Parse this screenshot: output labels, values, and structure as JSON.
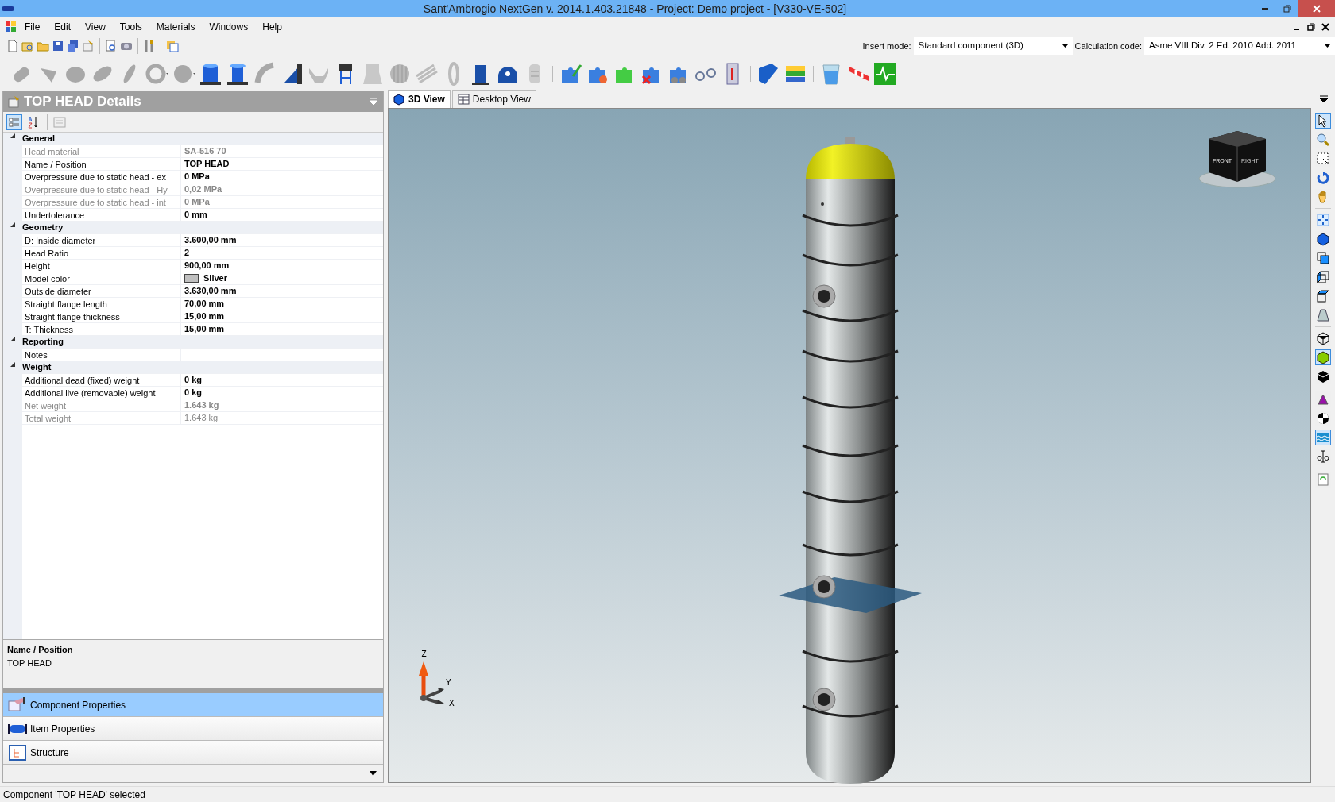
{
  "window": {
    "title": "Sant'Ambrogio NextGen  v. 2014.1.403.21848 - Project: Demo project - [V330-VE-502]"
  },
  "menu": [
    {
      "label": "File"
    },
    {
      "label": "Edit"
    },
    {
      "label": "View"
    },
    {
      "label": "Tools"
    },
    {
      "label": "Materials"
    },
    {
      "label": "Windows"
    },
    {
      "label": "Help"
    }
  ],
  "insert_mode": {
    "label": "Insert mode:",
    "value": "Standard component (3D)"
  },
  "calculation_code": {
    "label": "Calculation code:",
    "value": "Asme VIII Div. 2 Ed. 2010 Add. 2011"
  },
  "details_panel": {
    "title": "TOP HEAD Details",
    "categories": [
      {
        "name": "General",
        "expanded": true,
        "properties": [
          {
            "label": "Head material",
            "value": "SA-516 70",
            "readonly": true,
            "bold": true
          },
          {
            "label": "Name / Position",
            "value": "TOP HEAD",
            "readonly": false,
            "bold": true
          },
          {
            "label": "Overpressure due to static head - ex",
            "value": "0 MPa",
            "readonly": false,
            "bold": true
          },
          {
            "label": "Overpressure due to static head - Hy",
            "value": "0,02 MPa",
            "readonly": true,
            "bold": true
          },
          {
            "label": "Overpressure due to static head - int",
            "value": "0 MPa",
            "readonly": true,
            "bold": true
          },
          {
            "label": "Undertolerance",
            "value": "0 mm",
            "readonly": false,
            "bold": true
          }
        ]
      },
      {
        "name": "Geometry",
        "expanded": true,
        "properties": [
          {
            "label": "D:  Inside diameter",
            "value": "3.600,00 mm",
            "readonly": false,
            "bold": true
          },
          {
            "label": "Head Ratio",
            "value": "2",
            "readonly": false,
            "bold": true
          },
          {
            "label": "Height",
            "value": "900,00 mm",
            "readonly": false,
            "bold": true
          },
          {
            "label": "Model color",
            "value": "Silver",
            "readonly": false,
            "bold": true,
            "color": "#c0c0c0"
          },
          {
            "label": "Outside diameter",
            "value": "3.630,00 mm",
            "readonly": false,
            "bold": true
          },
          {
            "label": "Straight flange length",
            "value": "70,00 mm",
            "readonly": false,
            "bold": true
          },
          {
            "label": "Straight flange thickness",
            "value": "15,00 mm",
            "readonly": false,
            "bold": true
          },
          {
            "label": "T:  Thickness",
            "value": "15,00 mm",
            "readonly": false,
            "bold": true
          }
        ]
      },
      {
        "name": "Reporting",
        "expanded": true,
        "properties": [
          {
            "label": "Notes",
            "readonly": false
          }
        ]
      },
      {
        "name": "Weight",
        "expanded": true,
        "properties": [
          {
            "label": "Additional dead (fixed) weight",
            "value": "0 kg",
            "readonly": false,
            "bold": true
          },
          {
            "label": "Additional live (removable) weight",
            "value": "0 kg",
            "readonly": false,
            "bold": true
          },
          {
            "label": "Net weight",
            "value": "1.643 kg",
            "readonly": true,
            "bold": true
          },
          {
            "label": "Total weight",
            "value": "1.643 kg",
            "readonly": true,
            "bold": false
          }
        ]
      }
    ],
    "description": {
      "title": "Name / Position",
      "text": "TOP HEAD"
    }
  },
  "nav_buttons": [
    {
      "label": "Component Properties",
      "kind": "component",
      "selected": true
    },
    {
      "label": "Item Properties",
      "kind": "item",
      "selected": false
    },
    {
      "label": "Structure",
      "kind": "structure",
      "selected": false
    }
  ],
  "view_tabs": [
    {
      "label": "3D View",
      "kind": "model",
      "selected": true
    },
    {
      "label": "Desktop View",
      "kind": "desktop",
      "selected": false
    }
  ],
  "view_cube": {
    "faces": [
      "FRONT",
      "RIGHT"
    ]
  },
  "axes": {
    "labels": [
      "Z",
      "Y",
      "X"
    ]
  },
  "status_bar": {
    "text": "Component 'TOP HEAD' selected"
  }
}
